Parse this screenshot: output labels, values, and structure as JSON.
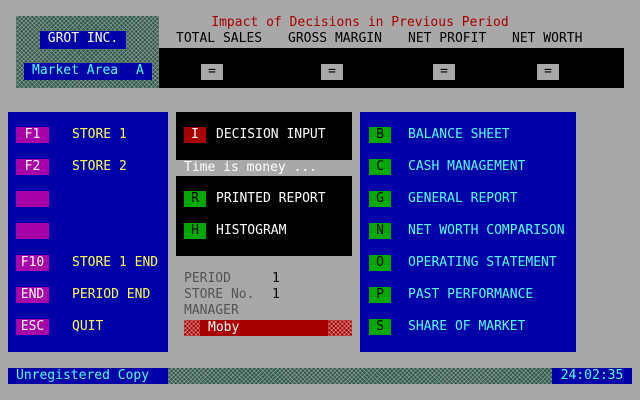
{
  "company": {
    "name": "GROT INC.",
    "market_area_label": "Market Area",
    "market_area_value": "A"
  },
  "impact": {
    "title": "Impact of Decisions in Previous Period",
    "columns": [
      {
        "label": "TOTAL SALES",
        "value": "="
      },
      {
        "label": "GROSS MARGIN",
        "value": "="
      },
      {
        "label": "NET PROFIT",
        "value": "="
      },
      {
        "label": "NET WORTH",
        "value": "="
      }
    ]
  },
  "function_keys": [
    {
      "key": "F1",
      "label": "STORE 1"
    },
    {
      "key": "F2",
      "label": "STORE 2"
    },
    {
      "key": "",
      "label": ""
    },
    {
      "key": "",
      "label": ""
    },
    {
      "key": "F10",
      "label": "STORE 1 END"
    },
    {
      "key": "END",
      "label": "PERIOD END"
    },
    {
      "key": "ESC",
      "label": "QUIT"
    }
  ],
  "decision": {
    "key": "I",
    "label": "DECISION INPUT"
  },
  "time_text": "Time is money ...",
  "reports": [
    {
      "key": "R",
      "label": "PRINTED REPORT"
    },
    {
      "key": "H",
      "label": "HISTOGRAM"
    }
  ],
  "info": {
    "period_label": "PERIOD",
    "period_value": "1",
    "store_label": "STORE No.",
    "store_value": "1",
    "manager_label": "MANAGER",
    "manager_value": "Moby"
  },
  "right_menu": [
    {
      "key": "B",
      "label": "BALANCE SHEET"
    },
    {
      "key": "C",
      "label": "CASH MANAGEMENT"
    },
    {
      "key": "G",
      "label": "GENERAL REPORT"
    },
    {
      "key": "N",
      "label": "NET WORTH COMPARISON"
    },
    {
      "key": "O",
      "label": "OPERATING STATEMENT"
    },
    {
      "key": "P",
      "label": "PAST PERFORMANCE"
    },
    {
      "key": "S",
      "label": "SHARE OF MARKET"
    }
  ],
  "status": {
    "registration": "Unregistered Copy",
    "clock": "24:02:35"
  },
  "colors": {
    "background": "#a8a8a8",
    "panel_blue": "#0000a8",
    "magenta": "#a800a8",
    "red": "#a80000",
    "green": "#00a800",
    "yellow": "#ffff55",
    "cyan": "#55ffff"
  }
}
